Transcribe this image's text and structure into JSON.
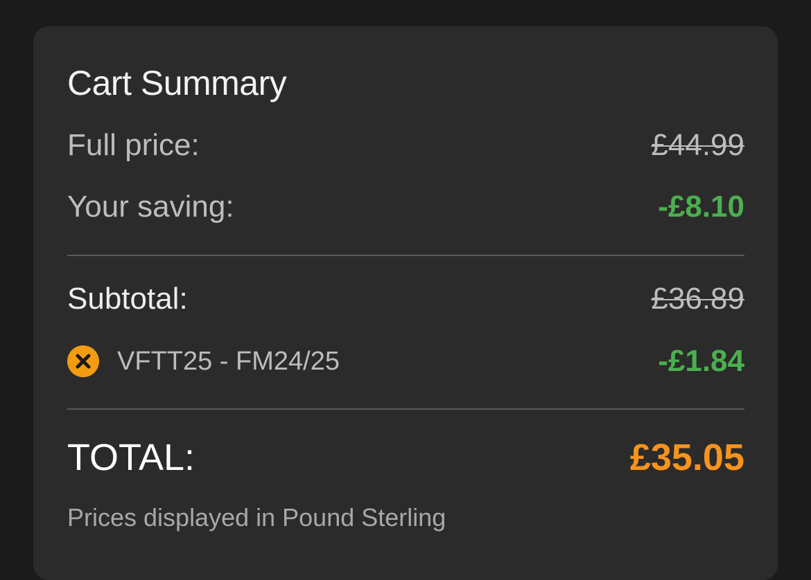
{
  "cart": {
    "title": "Cart Summary",
    "full_price": {
      "label": "Full price:",
      "value": "£44.99"
    },
    "saving": {
      "label": "Your saving:",
      "value": "-£8.10"
    },
    "subtotal": {
      "label": "Subtotal:",
      "value": "£36.89"
    },
    "coupon": {
      "code": "VFTT25 - FM24/25",
      "value": "-£1.84",
      "icon": "remove-coupon-icon"
    },
    "total": {
      "label": "TOTAL:",
      "value": "£35.05"
    },
    "footnote": "Prices displayed in Pound Sterling"
  },
  "colors": {
    "background": "#1b1b1b",
    "card": "#2b2b2b",
    "saving_green": "#4caf50",
    "accent_orange": "#f7931e"
  }
}
